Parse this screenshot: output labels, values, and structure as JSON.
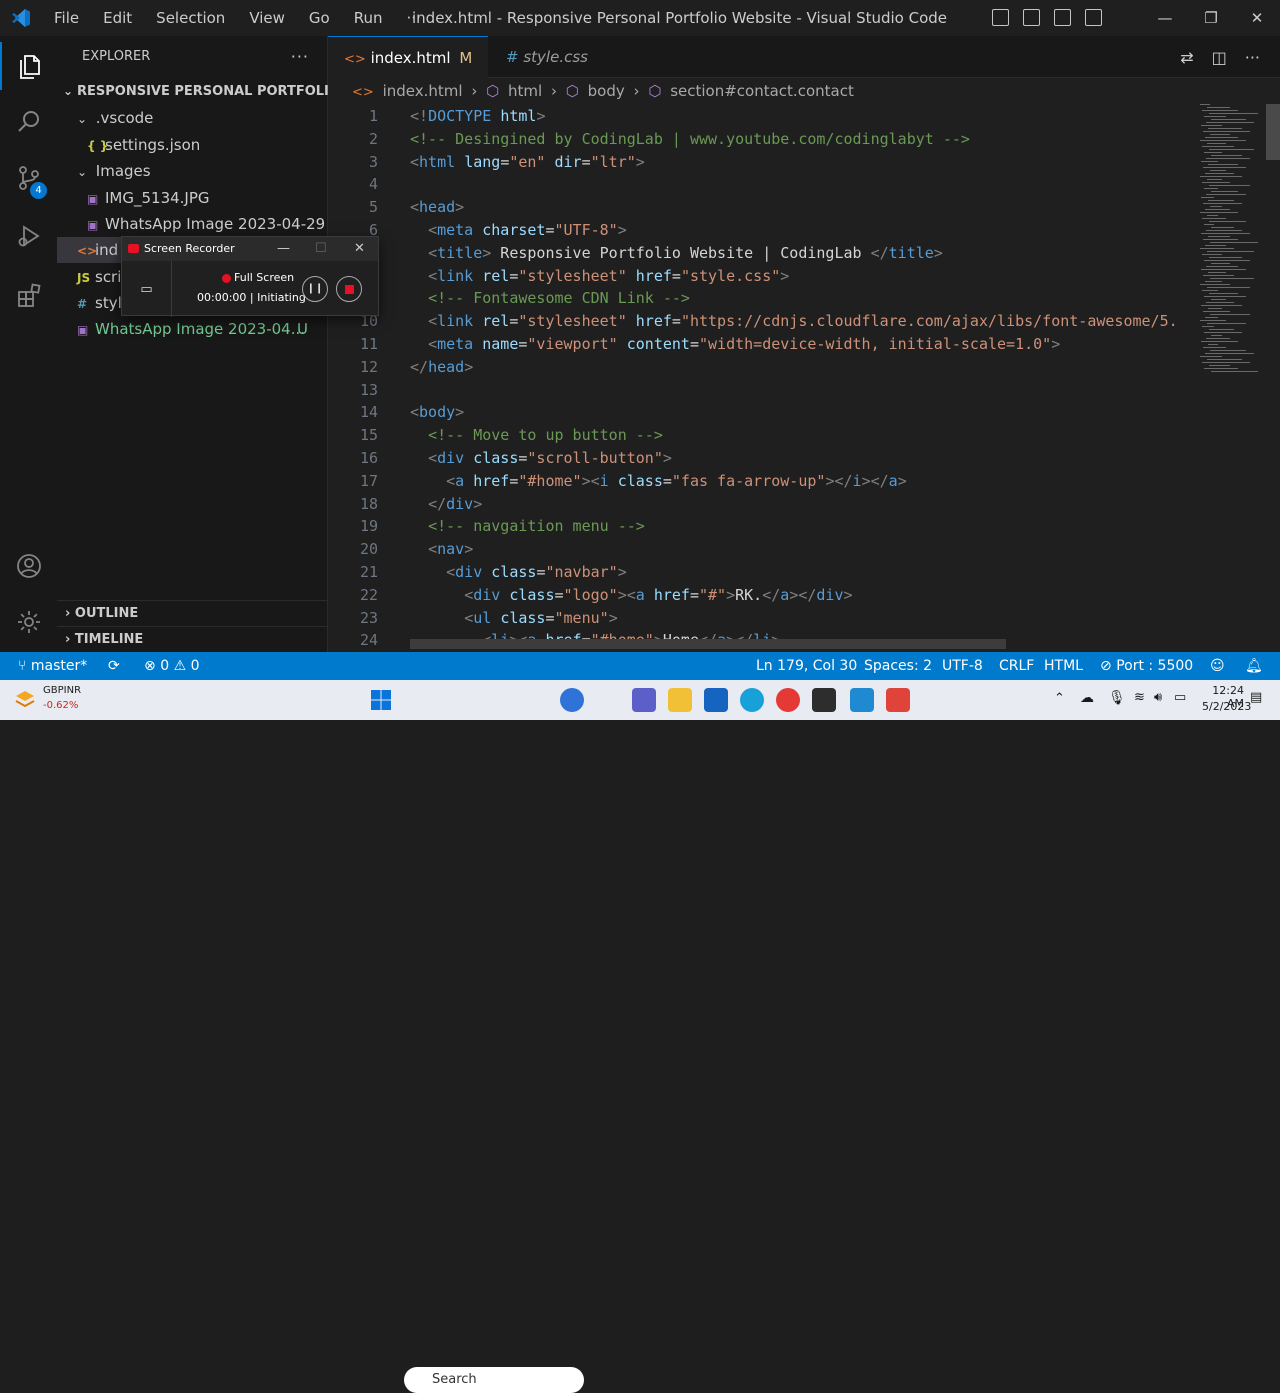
{
  "titlebar": {
    "menus": [
      "File",
      "Edit",
      "Selection",
      "View",
      "Go",
      "Run",
      "···"
    ],
    "title": "index.html - Responsive Personal Portfolio Website - Visual Studio Code"
  },
  "activity": {
    "scm_badge": "4"
  },
  "explorer": {
    "heading": "EXPLORER",
    "more": "···",
    "root": "RESPONSIVE PERSONAL PORTFOLIO ...",
    "items": [
      {
        "label": ".vscode",
        "icon": "",
        "kind": "folder"
      },
      {
        "label": "settings.json",
        "icon": "{ }",
        "kind": "file"
      },
      {
        "label": "Images",
        "icon": "",
        "kind": "folder"
      },
      {
        "label": "IMG_5134.JPG",
        "icon": "▣",
        "kind": "file"
      },
      {
        "label": "WhatsApp Image 2023-04-29 ...",
        "icon": "▣",
        "kind": "file"
      },
      {
        "label": "ind",
        "icon": "<>",
        "kind": "file"
      },
      {
        "label": "scri",
        "icon": "JS",
        "kind": "file"
      },
      {
        "label": "styl",
        "icon": "#",
        "kind": "file"
      },
      {
        "label": "WhatsApp Image 2023-04...",
        "icon": "▣",
        "kind": "file",
        "status": "U"
      }
    ],
    "outline": "OUTLINE",
    "timeline": "TIMELINE"
  },
  "tabs": [
    {
      "label": "index.html",
      "icon": "<>",
      "modified": "M",
      "close": "✕"
    },
    {
      "label": "style.css",
      "icon": "#"
    }
  ],
  "breadcrumb": [
    "index.html",
    "html",
    "body",
    "section#contact.contact"
  ],
  "editor": {
    "lines": [
      {
        "n": "1",
        "s": [
          [
            "t",
            "<!"
          ],
          [
            "tn",
            "DOCTYPE"
          ],
          [
            "tx",
            " "
          ],
          [
            "at",
            "html"
          ],
          [
            "t",
            ">"
          ]
        ]
      },
      {
        "n": "2",
        "s": [
          [
            "cm",
            "<!-- Desingined by CodingLab | www.youtube.com/codinglabyt -->"
          ]
        ]
      },
      {
        "n": "3",
        "s": [
          [
            "t",
            "<"
          ],
          [
            "tn",
            "html"
          ],
          [
            "tx",
            " "
          ],
          [
            "at",
            "lang"
          ],
          [
            "tx",
            "="
          ],
          [
            "st",
            "\"en\""
          ],
          [
            "tx",
            " "
          ],
          [
            "at",
            "dir"
          ],
          [
            "tx",
            "="
          ],
          [
            "st",
            "\"ltr\""
          ],
          [
            "t",
            ">"
          ]
        ]
      },
      {
        "n": "4",
        "s": []
      },
      {
        "n": "5",
        "s": [
          [
            "t",
            "<"
          ],
          [
            "tn",
            "head"
          ],
          [
            "t",
            ">"
          ]
        ]
      },
      {
        "n": "6",
        "s": [
          [
            "tx",
            "  "
          ],
          [
            "t",
            "<"
          ],
          [
            "tn",
            "meta"
          ],
          [
            "tx",
            " "
          ],
          [
            "at",
            "charset"
          ],
          [
            "tx",
            "="
          ],
          [
            "st",
            "\"UTF-8\""
          ],
          [
            "t",
            ">"
          ]
        ]
      },
      {
        "n": "7",
        "s": [
          [
            "tx",
            "  "
          ],
          [
            "t",
            "<"
          ],
          [
            "tn",
            "title"
          ],
          [
            "t",
            ">"
          ],
          [
            "tx",
            " Responsive Portfolio Website | CodingLab "
          ],
          [
            "t",
            "</"
          ],
          [
            "tn",
            "title"
          ],
          [
            "t",
            ">"
          ]
        ]
      },
      {
        "n": "8",
        "s": [
          [
            "tx",
            "  "
          ],
          [
            "t",
            "<"
          ],
          [
            "tn",
            "link"
          ],
          [
            "tx",
            " "
          ],
          [
            "at",
            "rel"
          ],
          [
            "tx",
            "="
          ],
          [
            "st",
            "\"stylesheet\""
          ],
          [
            "tx",
            " "
          ],
          [
            "at",
            "href"
          ],
          [
            "tx",
            "="
          ],
          [
            "st",
            "\"style.css\""
          ],
          [
            "t",
            ">"
          ]
        ]
      },
      {
        "n": "9",
        "s": [
          [
            "tx",
            "  "
          ],
          [
            "cm",
            "<!-- Fontawesome CDN Link -->"
          ]
        ]
      },
      {
        "n": "10",
        "s": [
          [
            "tx",
            "  "
          ],
          [
            "t",
            "<"
          ],
          [
            "tn",
            "link"
          ],
          [
            "tx",
            " "
          ],
          [
            "at",
            "rel"
          ],
          [
            "tx",
            "="
          ],
          [
            "st",
            "\"stylesheet\""
          ],
          [
            "tx",
            " "
          ],
          [
            "at",
            "href"
          ],
          [
            "tx",
            "="
          ],
          [
            "st",
            "\"https://cdnjs.cloudflare.com/ajax/libs/font-awesome/5."
          ]
        ]
      },
      {
        "n": "11",
        "s": [
          [
            "tx",
            "  "
          ],
          [
            "t",
            "<"
          ],
          [
            "tn",
            "meta"
          ],
          [
            "tx",
            " "
          ],
          [
            "at",
            "name"
          ],
          [
            "tx",
            "="
          ],
          [
            "st",
            "\"viewport\""
          ],
          [
            "tx",
            " "
          ],
          [
            "at",
            "content"
          ],
          [
            "tx",
            "="
          ],
          [
            "st",
            "\"width=device-width, initial-scale=1.0\""
          ],
          [
            "t",
            ">"
          ]
        ]
      },
      {
        "n": "12",
        "s": [
          [
            "t",
            "</"
          ],
          [
            "tn",
            "head"
          ],
          [
            "t",
            ">"
          ]
        ]
      },
      {
        "n": "13",
        "s": []
      },
      {
        "n": "14",
        "s": [
          [
            "t",
            "<"
          ],
          [
            "tn",
            "body"
          ],
          [
            "t",
            ">"
          ]
        ]
      },
      {
        "n": "15",
        "s": [
          [
            "tx",
            "  "
          ],
          [
            "cm",
            "<!-- Move to up button -->"
          ]
        ]
      },
      {
        "n": "16",
        "s": [
          [
            "tx",
            "  "
          ],
          [
            "t",
            "<"
          ],
          [
            "tn",
            "div"
          ],
          [
            "tx",
            " "
          ],
          [
            "at",
            "class"
          ],
          [
            "tx",
            "="
          ],
          [
            "st",
            "\"scroll-button\""
          ],
          [
            "t",
            ">"
          ]
        ]
      },
      {
        "n": "17",
        "s": [
          [
            "tx",
            "    "
          ],
          [
            "t",
            "<"
          ],
          [
            "tn",
            "a"
          ],
          [
            "tx",
            " "
          ],
          [
            "at",
            "href"
          ],
          [
            "tx",
            "="
          ],
          [
            "st",
            "\"#home\""
          ],
          [
            "t",
            "><"
          ],
          [
            "tn",
            "i"
          ],
          [
            "tx",
            " "
          ],
          [
            "at",
            "class"
          ],
          [
            "tx",
            "="
          ],
          [
            "st",
            "\"fas fa-arrow-up\""
          ],
          [
            "t",
            "></"
          ],
          [
            "tn",
            "i"
          ],
          [
            "t",
            "></"
          ],
          [
            "tn",
            "a"
          ],
          [
            "t",
            ">"
          ]
        ]
      },
      {
        "n": "18",
        "s": [
          [
            "tx",
            "  "
          ],
          [
            "t",
            "</"
          ],
          [
            "tn",
            "div"
          ],
          [
            "t",
            ">"
          ]
        ]
      },
      {
        "n": "19",
        "s": [
          [
            "tx",
            "  "
          ],
          [
            "cm",
            "<!-- navgaition menu -->"
          ]
        ]
      },
      {
        "n": "20",
        "s": [
          [
            "tx",
            "  "
          ],
          [
            "t",
            "<"
          ],
          [
            "tn",
            "nav"
          ],
          [
            "t",
            ">"
          ]
        ]
      },
      {
        "n": "21",
        "s": [
          [
            "tx",
            "    "
          ],
          [
            "t",
            "<"
          ],
          [
            "tn",
            "div"
          ],
          [
            "tx",
            " "
          ],
          [
            "at",
            "class"
          ],
          [
            "tx",
            "="
          ],
          [
            "st",
            "\"navbar\""
          ],
          [
            "t",
            ">"
          ]
        ]
      },
      {
        "n": "22",
        "s": [
          [
            "tx",
            "      "
          ],
          [
            "t",
            "<"
          ],
          [
            "tn",
            "div"
          ],
          [
            "tx",
            " "
          ],
          [
            "at",
            "class"
          ],
          [
            "tx",
            "="
          ],
          [
            "st",
            "\"logo\""
          ],
          [
            "t",
            "><"
          ],
          [
            "tn",
            "a"
          ],
          [
            "tx",
            " "
          ],
          [
            "at",
            "href"
          ],
          [
            "tx",
            "="
          ],
          [
            "st",
            "\"#\""
          ],
          [
            "t",
            ">"
          ],
          [
            "tx",
            "RK."
          ],
          [
            "t",
            "</"
          ],
          [
            "tn",
            "a"
          ],
          [
            "t",
            "></"
          ],
          [
            "tn",
            "div"
          ],
          [
            "t",
            ">"
          ]
        ]
      },
      {
        "n": "23",
        "s": [
          [
            "tx",
            "      "
          ],
          [
            "t",
            "<"
          ],
          [
            "tn",
            "ul"
          ],
          [
            "tx",
            " "
          ],
          [
            "at",
            "class"
          ],
          [
            "tx",
            "="
          ],
          [
            "st",
            "\"menu\""
          ],
          [
            "t",
            ">"
          ]
        ]
      },
      {
        "n": "24",
        "s": [
          [
            "tx",
            "        "
          ],
          [
            "t",
            "<"
          ],
          [
            "tn",
            "li"
          ],
          [
            "t",
            "><"
          ],
          [
            "tn",
            "a"
          ],
          [
            "tx",
            " "
          ],
          [
            "at",
            "href"
          ],
          [
            "tx",
            "="
          ],
          [
            "st",
            "\"#home\""
          ],
          [
            "t",
            ">"
          ],
          [
            "tx",
            "Home"
          ],
          [
            "t",
            "</"
          ],
          [
            "tn",
            "a"
          ],
          [
            "t",
            "></"
          ],
          [
            "tn",
            "li"
          ],
          [
            "t",
            ">"
          ]
        ]
      }
    ]
  },
  "statusbar": {
    "branch": "master*",
    "errors": "0",
    "warnings": "0",
    "position": "Ln 179, Col 30",
    "spaces": "Spaces: 2",
    "encoding": "UTF-8",
    "eol": "CRLF",
    "language": "HTML",
    "port": "Port : 5500"
  },
  "recorder": {
    "title": "Screen Recorder",
    "mode": "Full Screen",
    "time": "00:00:00",
    "state": "Initiating"
  },
  "taskbar": {
    "ticker": "GBPINR",
    "change": "-0.62%",
    "search": "Search",
    "time": "12:24 AM",
    "date": "5/2/2023"
  },
  "colors": {
    "accent": "#007acc",
    "untracked": "#73c991",
    "record": "#e81123"
  }
}
